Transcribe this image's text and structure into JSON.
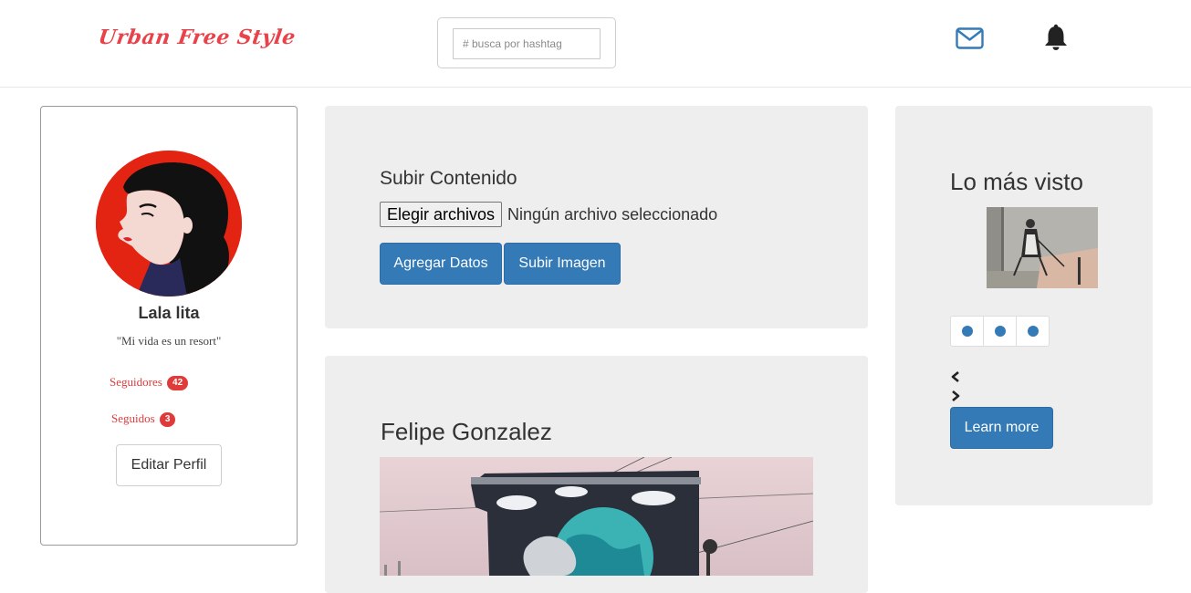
{
  "header": {
    "logo_text": "Urban Free Style",
    "search_placeholder": "# busca por hashtag"
  },
  "profile": {
    "name": "Lala lita",
    "quote": "\"Mi vida es un resort\"",
    "followers_label": "Seguidores",
    "followers_count": "42",
    "following_label": "Seguidos",
    "following_count": "3",
    "edit_label": "Editar Perfil"
  },
  "upload": {
    "title": "Subir Contenido",
    "file_button": "Elegir archivos",
    "file_status": "Ningún archivo seleccionado",
    "add_data_label": "Agregar Datos",
    "upload_image_label": "Subir Imagen"
  },
  "post": {
    "author": "Felipe Gonzalez"
  },
  "trending": {
    "title": "Lo más visto",
    "learn_more_label": "Learn more"
  },
  "colors": {
    "brand_red": "#e8424a",
    "primary_blue": "#337ab7",
    "panel_gray": "#eeeeee"
  },
  "icons": {
    "mail": "mail-icon",
    "bell": "bell-icon",
    "prev": "chevron-left-icon",
    "next": "chevron-right-icon"
  }
}
